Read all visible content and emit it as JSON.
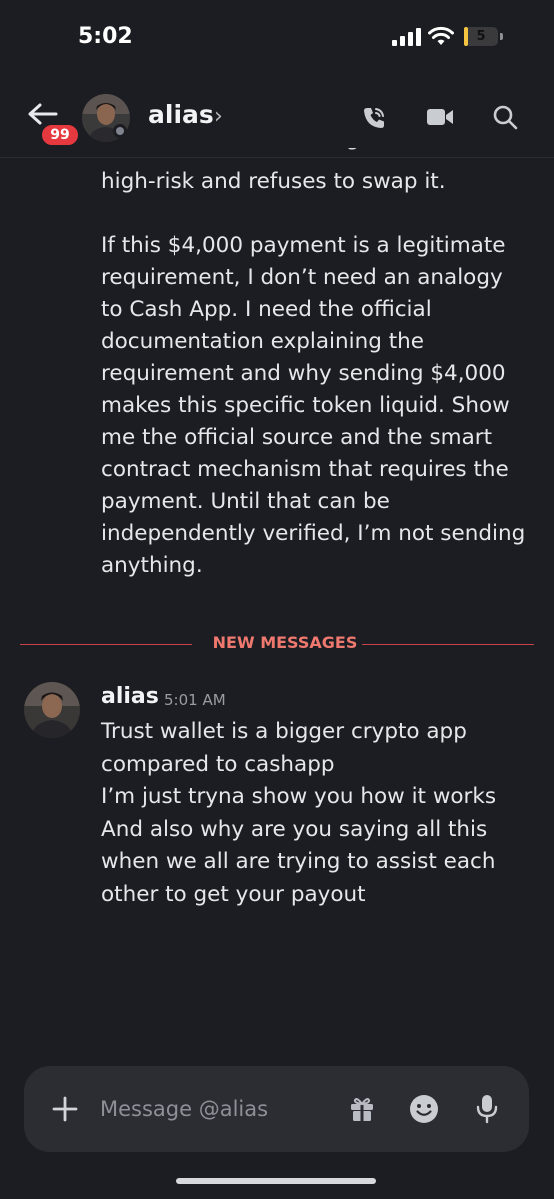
{
  "status_bar": {
    "time": "5:02",
    "battery_level": "5",
    "battery_fraction": 0.05,
    "icons": [
      "signal-icon",
      "wifi-icon",
      "battery-icon"
    ]
  },
  "header": {
    "back_icon": "arrow-left-icon",
    "unread_badge": "99",
    "name": "alias",
    "chevron": "›",
    "status": "offline",
    "actions": [
      "phone-call-icon",
      "video-camera-icon",
      "search-icon"
    ]
  },
  "messages": {
    "previous_tail": "high-risk and refuses to swap it.",
    "previous_paragraph": "If this $4,000 payment is a legitimate requirement, I don’t need an analogy to Cash App. I need the official documentation explaining the requirement and why sending $4,000 makes this specific token liquid. Show me the official source and the smart contract mechanism that requires the payment. Until that can be independently verified, I’m not sending anything.",
    "new_messages_label": "NEW MESSAGES",
    "reply": {
      "author": "alias",
      "time": "5:01 AM",
      "lines": [
        "Trust wallet is a bigger crypto app",
        "compared to cashapp",
        "I’m just tryna show you how it works",
        "And also why are you saying all this",
        "when we all are trying to assist each",
        "other to get your payout"
      ]
    }
  },
  "composer": {
    "placeholder": "Message @alias",
    "icons": [
      "plus-icon",
      "gift-icon",
      "emoji-icon",
      "microphone-icon"
    ]
  },
  "colors": {
    "background": "#1c1d22",
    "new_messages": "#f0796f",
    "divider": "#c8434a",
    "badge": "#e5393f",
    "composer": "#2b2d33",
    "battery": "#f5c542"
  }
}
